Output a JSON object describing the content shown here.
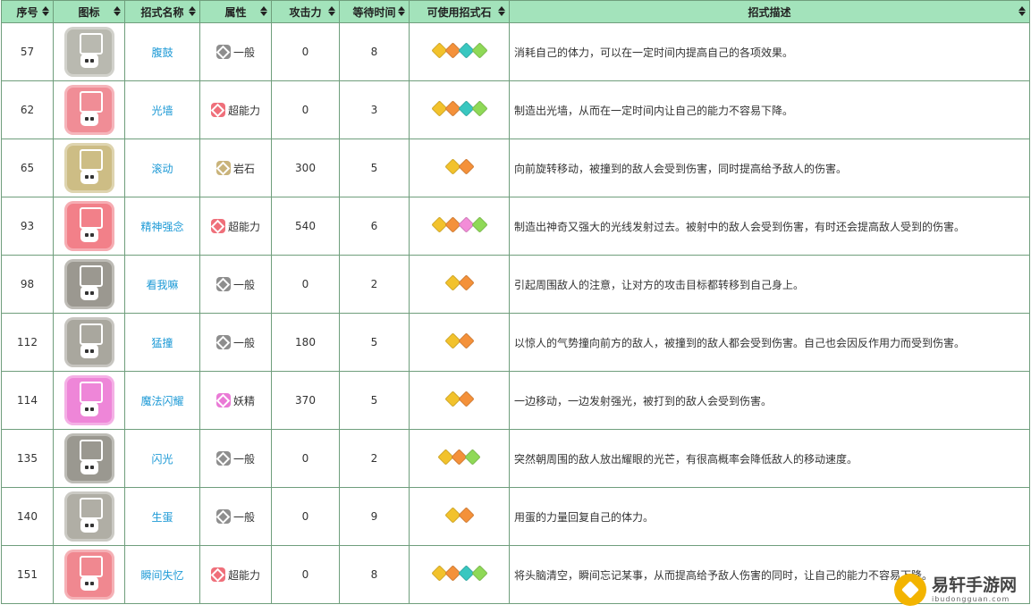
{
  "headers": [
    "序号",
    "图标",
    "招式名称",
    "属性",
    "攻击力",
    "等待时间",
    "可使用招式石",
    "招式描述"
  ],
  "stone_colors": {
    "yellow": "#f2c22c",
    "orange": "#f4913a",
    "pink": "#f38dd8",
    "teal": "#39c7c0",
    "green": "#8fd957"
  },
  "type_colors": {
    "一般": "#8e8e8e",
    "超能力": "#ef6f7a",
    "岩石": "#c9b37a",
    "妖精": "#ea7ad6"
  },
  "rows": [
    {
      "id": "57",
      "icon": "gray-grid-icon",
      "icon_color": "#b9b9b0",
      "name": "腹鼓",
      "type": "一般",
      "attack": "0",
      "wait": "8",
      "stones": [
        "yellow",
        "orange",
        "teal",
        "green"
      ],
      "desc": "消耗自己的体力，可以在一定时间内提高自己的各项效果。"
    },
    {
      "id": "62",
      "icon": "pink-shield-icon",
      "icon_color": "#f08d96",
      "name": "光墙",
      "type": "超能力",
      "attack": "0",
      "wait": "3",
      "stones": [
        "yellow",
        "orange",
        "teal",
        "green"
      ],
      "desc": "制造出光墙，从而在一定时间内让自己的能力不容易下降。"
    },
    {
      "id": "65",
      "icon": "rock-roll-icon",
      "icon_color": "#cdbd85",
      "name": "滚动",
      "type": "岩石",
      "attack": "300",
      "wait": "5",
      "stones": [
        "yellow",
        "orange"
      ],
      "desc": "向前旋转移动，被撞到的敌人会受到伤害，同时提高给予敌人的伤害。"
    },
    {
      "id": "93",
      "icon": "psychic-beam-icon",
      "icon_color": "#f28089",
      "name": "精神强念",
      "type": "超能力",
      "attack": "540",
      "wait": "6",
      "stones": [
        "yellow",
        "orange",
        "pink",
        "green"
      ],
      "desc": "制造出神奇又强大的光线发射过去。被射中的敌人会受到伤害，有时还会提高敌人受到的伤害。"
    },
    {
      "id": "98",
      "icon": "hand-point-icon",
      "icon_color": "#9b9890",
      "name": "看我嘛",
      "type": "一般",
      "attack": "0",
      "wait": "2",
      "stones": [
        "yellow",
        "orange"
      ],
      "desc": "引起周围敌人的注意，让对方的攻击目标都转移到自己身上。"
    },
    {
      "id": "112",
      "icon": "tackle-icon",
      "icon_color": "#a9a79e",
      "name": "猛撞",
      "type": "一般",
      "attack": "180",
      "wait": "5",
      "stones": [
        "yellow",
        "orange"
      ],
      "desc": "以惊人的气势撞向前方的敌人，被撞到的敌人都会受到伤害。自己也会因反作用力而受到伤害。"
    },
    {
      "id": "114",
      "icon": "fairy-flash-icon",
      "icon_color": "#ee86d8",
      "name": "魔法闪耀",
      "type": "妖精",
      "attack": "370",
      "wait": "5",
      "stones": [
        "yellow",
        "orange"
      ],
      "desc": "一边移动，一边发射强光，被打到的敌人会受到伤害。"
    },
    {
      "id": "135",
      "icon": "flash-icon",
      "icon_color": "#9a9890",
      "name": "闪光",
      "type": "一般",
      "attack": "0",
      "wait": "2",
      "stones": [
        "yellow",
        "orange",
        "green"
      ],
      "desc": "突然朝周围的敌人放出耀眼的光芒，有很高概率会降低敌人的移动速度。"
    },
    {
      "id": "140",
      "icon": "egg-heal-icon",
      "icon_color": "#b0aea5",
      "name": "生蛋",
      "type": "一般",
      "attack": "0",
      "wait": "9",
      "stones": [
        "yellow",
        "orange"
      ],
      "desc": "用蛋的力量回复自己的体力。"
    },
    {
      "id": "151",
      "icon": "amnesia-icon",
      "icon_color": "#f08890",
      "name": "瞬间失忆",
      "type": "超能力",
      "attack": "0",
      "wait": "8",
      "stones": [
        "yellow",
        "orange",
        "teal",
        "green"
      ],
      "desc": "将头脑清空，瞬间忘记某事，从而提高给予敌人伤害的同时，让自己的能力不容易下降。"
    }
  ],
  "watermark": {
    "cn": "易轩手游网",
    "en": "ibudongguan.com"
  }
}
